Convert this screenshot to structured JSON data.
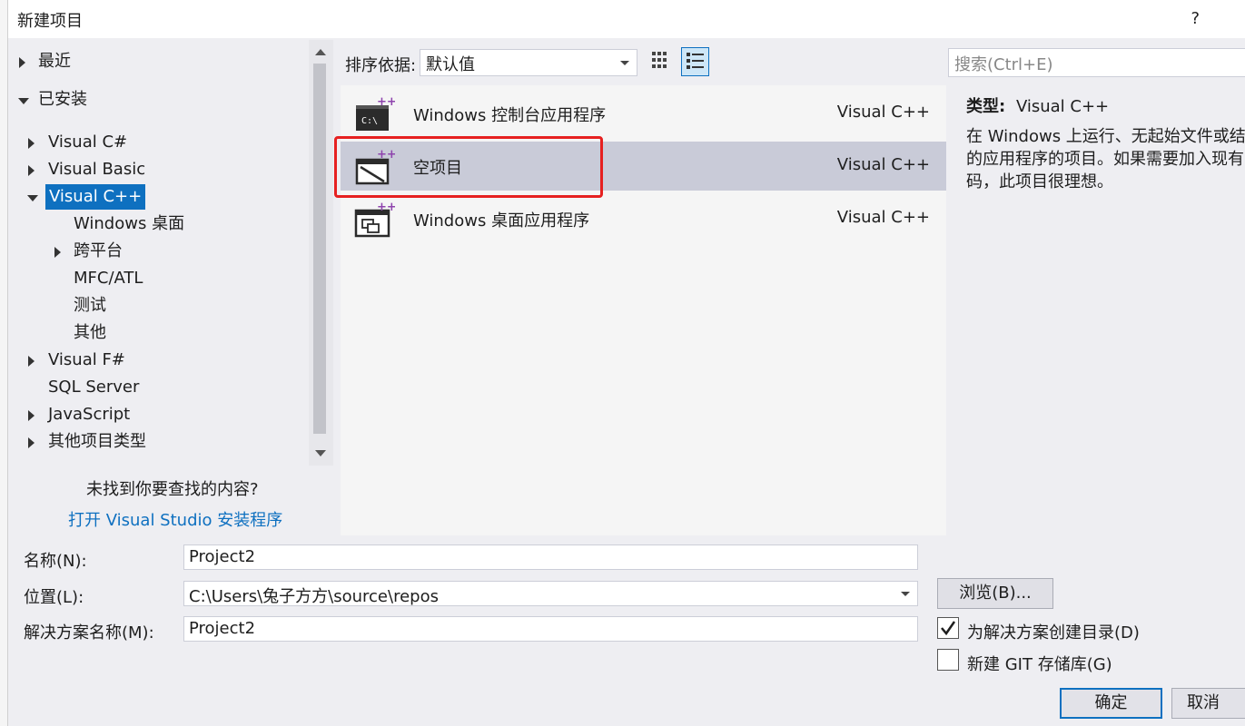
{
  "dialog": {
    "title": "新建项目",
    "help": "?"
  },
  "tree": {
    "recent": "最近",
    "installed": "已安装",
    "items": [
      "Visual C#",
      "Visual Basic",
      "Visual C++",
      "Windows 桌面",
      "跨平台",
      "MFC/ATL",
      "测试",
      "其他",
      "Visual F#",
      "SQL Server",
      "JavaScript",
      "其他项目类型"
    ],
    "not_found": "未找到你要查找的内容?",
    "install_link": "打开 Visual Studio 安装程序"
  },
  "sort": {
    "label": "排序依据:",
    "value": "默认值"
  },
  "templates": [
    {
      "name": "Windows 控制台应用程序",
      "lang": "Visual C++",
      "icon": "console-app-icon"
    },
    {
      "name": "空项目",
      "lang": "Visual C++",
      "icon": "empty-project-icon"
    },
    {
      "name": "Windows 桌面应用程序",
      "lang": "Visual C++",
      "icon": "desktop-app-icon"
    }
  ],
  "search": {
    "placeholder": "搜索(Ctrl+E)"
  },
  "details": {
    "type_label": "类型:",
    "type_value": "Visual C++",
    "desc_lines": [
      "在 Windows 上运行、无起始文件或结构",
      "的应用程序的项目。如果需要加入现有",
      "码，此项目很理想。"
    ]
  },
  "form": {
    "name_label": "名称(N):",
    "name_value": "Project2",
    "location_label": "位置(L):",
    "location_value": "C:\\Users\\兔子方方\\source\\repos",
    "solution_label": "解决方案名称(M):",
    "solution_value": "Project2",
    "browse": "浏览(B)...",
    "create_dir": "为解决方案创建目录(D)",
    "create_dir_checked": true,
    "git": "新建 GIT 存储库(G)",
    "git_checked": false
  },
  "buttons": {
    "ok": "确定",
    "cancel": "取消"
  },
  "colors": {
    "accent": "#0e70c0",
    "selection_row": "#c9cbd8",
    "highlight_box": "#e62020",
    "icon_plus": "#8e44ad"
  }
}
